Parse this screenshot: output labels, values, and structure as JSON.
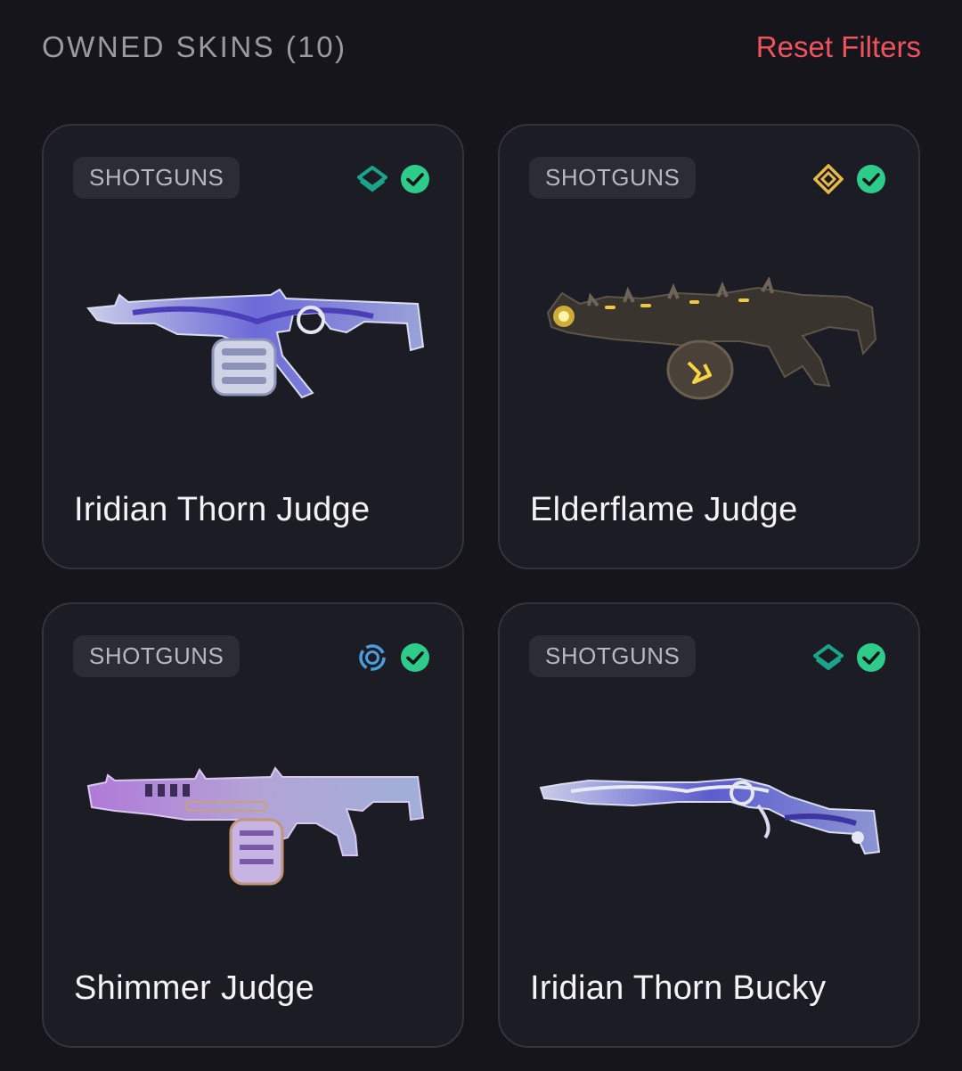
{
  "header": {
    "title": "OWNED SKINS (10)",
    "reset_label": "Reset Filters"
  },
  "colors": {
    "background": "#15151b",
    "card": "#1c1c24",
    "accent_reset": "#f0525e",
    "owned_check": "#2ecc8a",
    "tier_deluxe": "#1aa58a",
    "tier_exclusive": "#e8b94a",
    "tier_select": "#4a9ee0"
  },
  "cards": [
    {
      "category": "SHOTGUNS",
      "name": "Iridian Thorn Judge",
      "tier_icon": "deluxe-tier-icon",
      "owned_icon": "check-circle-icon"
    },
    {
      "category": "SHOTGUNS",
      "name": "Elderflame Judge",
      "tier_icon": "exclusive-tier-icon",
      "owned_icon": "check-circle-icon"
    },
    {
      "category": "SHOTGUNS",
      "name": "Shimmer Judge",
      "tier_icon": "select-tier-icon",
      "owned_icon": "check-circle-icon"
    },
    {
      "category": "SHOTGUNS",
      "name": "Iridian Thorn Bucky",
      "tier_icon": "deluxe-tier-icon",
      "owned_icon": "check-circle-icon"
    }
  ]
}
